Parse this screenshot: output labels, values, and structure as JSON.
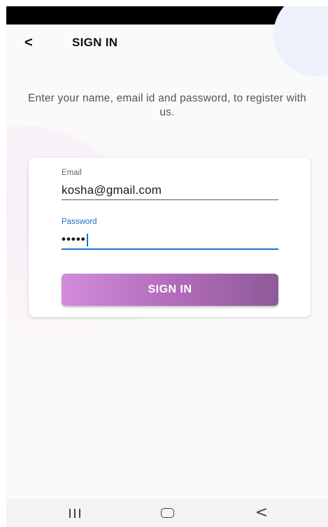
{
  "header": {
    "back_icon": "chevron-left-icon",
    "back_glyph": "<",
    "title": "SIGN IN"
  },
  "intro": {
    "text": "Enter your name, email id and password, to register with us."
  },
  "form": {
    "email": {
      "label": "Email",
      "value": "kosha@gmail.com"
    },
    "password": {
      "label": "Password",
      "masked_value": "•••••",
      "focused": true
    },
    "submit_label": "SIGN IN"
  },
  "nav_bar": {
    "recents_icon": "recent-apps-icon",
    "home_icon": "home-icon",
    "back_icon": "back-icon",
    "back_glyph": "<"
  },
  "colors": {
    "accent": "#1a73c9",
    "button_gradient_start": "#d28cdb",
    "button_gradient_end": "#8e5a99",
    "status_bar": "#000000"
  }
}
